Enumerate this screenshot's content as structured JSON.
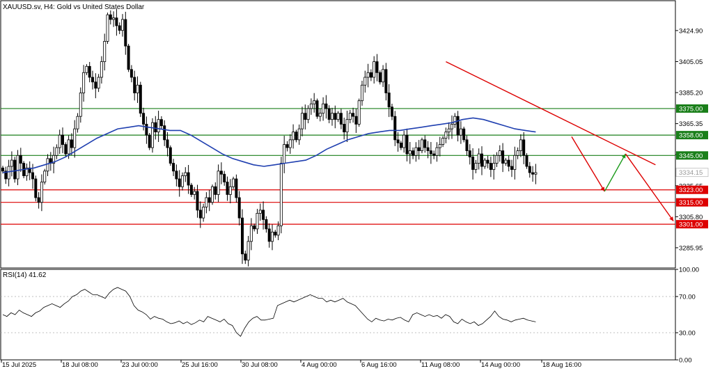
{
  "chart_data": {
    "type": "candlestick",
    "symbol_title": "XAUUSD.sv, H4:  Gold vs United States Dollar",
    "ylim": [
      3273,
      3444
    ],
    "y_ticks": [
      3424.9,
      3405.05,
      3385.2,
      3365.35,
      3345.5,
      3325.65,
      3305.8,
      3285.95
    ],
    "x_ticks": [
      "15 Jul 2025",
      "18 Jul 08:00",
      "23 Jul 00:00",
      "25 Jul 16:00",
      "30 Jul 08:00",
      "4 Aug 00:00",
      "6 Aug 16:00",
      "11 Aug 08:00",
      "14 Aug 00:00",
      "18 Aug 16:00"
    ],
    "current_price": "3334.15",
    "levels": [
      {
        "value": 3375.0,
        "label": "3375.00",
        "color": "#1a7f1a"
      },
      {
        "value": 3358.0,
        "label": "3358.00",
        "color": "#1a7f1a"
      },
      {
        "value": 3345.0,
        "label": "3345.00",
        "color": "#1a7f1a"
      },
      {
        "value": 3323.0,
        "label": "3323.00",
        "color": "#dd0000"
      },
      {
        "value": 3315.0,
        "label": "3315.00",
        "color": "#dd0000"
      },
      {
        "value": 3301.0,
        "label": "3301.00",
        "color": "#dd0000"
      }
    ],
    "closes": [
      3335,
      3330,
      3338,
      3342,
      3330,
      3345,
      3340,
      3332,
      3337,
      3334,
      3330,
      3318,
      3315,
      3328,
      3335,
      3343,
      3340,
      3345,
      3350,
      3358,
      3352,
      3346,
      3355,
      3350,
      3362,
      3370,
      3385,
      3398,
      3402,
      3395,
      3392,
      3388,
      3395,
      3405,
      3418,
      3435,
      3432,
      3433,
      3428,
      3425,
      3432,
      3415,
      3400,
      3395,
      3385,
      3390,
      3372,
      3365,
      3358,
      3350,
      3366,
      3360,
      3368,
      3364,
      3355,
      3350,
      3340,
      3335,
      3330,
      3325,
      3332,
      3334,
      3326,
      3320,
      3322,
      3310,
      3305,
      3312,
      3318,
      3315,
      3325,
      3320,
      3335,
      3333,
      3328,
      3320,
      3325,
      3330,
      3318,
      3305,
      3282,
      3278,
      3290,
      3300,
      3298,
      3308,
      3310,
      3304,
      3298,
      3290,
      3296,
      3294,
      3300,
      3340,
      3352,
      3350,
      3355,
      3360,
      3355,
      3362,
      3372,
      3368,
      3375,
      3378,
      3380,
      3370,
      3372,
      3378,
      3375,
      3368,
      3372,
      3368,
      3372,
      3365,
      3360,
      3368,
      3372,
      3370,
      3365,
      3380,
      3390,
      3395,
      3398,
      3395,
      3405,
      3398,
      3392,
      3400,
      3385,
      3376,
      3370,
      3355,
      3353,
      3350,
      3358,
      3346,
      3348,
      3345,
      3350,
      3348,
      3355,
      3350,
      3348,
      3346,
      3345,
      3350,
      3352,
      3356,
      3360,
      3362,
      3365,
      3370,
      3358,
      3362,
      3355,
      3348,
      3344,
      3336,
      3340,
      3346,
      3338,
      3342,
      3340,
      3336,
      3340,
      3345,
      3348,
      3340,
      3342,
      3338,
      3336,
      3345,
      3348,
      3355,
      3345,
      3338,
      3334,
      3333,
      3334
    ],
    "ma_values": [
      3334,
      3335,
      3336,
      3337,
      3339,
      3341,
      3344,
      3348,
      3352,
      3356,
      3359,
      3362,
      3363,
      3364,
      3363,
      3362,
      3361,
      3361,
      3358,
      3354,
      3350,
      3346,
      3343,
      3341,
      3339,
      3338,
      3339,
      3340,
      3341,
      3342,
      3345,
      3349,
      3352,
      3355,
      3357,
      3359,
      3360,
      3361,
      3361,
      3362,
      3363,
      3364,
      3365,
      3366,
      3368,
      3369,
      3368,
      3366,
      3364,
      3362,
      3361,
      3360
    ],
    "rsi": {
      "label": "RSI(14) 41.62",
      "ylim": [
        0,
        100
      ],
      "y_ticks": [
        "100.00",
        "70.00",
        "30.00",
        "0.00"
      ],
      "values": [
        50,
        48,
        52,
        50,
        55,
        52,
        50,
        48,
        52,
        54,
        58,
        60,
        62,
        60,
        58,
        62,
        65,
        70,
        72,
        76,
        78,
        75,
        72,
        72,
        70,
        68,
        74,
        78,
        80,
        78,
        76,
        70,
        60,
        55,
        53,
        50,
        45,
        48,
        46,
        45,
        42,
        40,
        41,
        43,
        40,
        42,
        39,
        41,
        44,
        42,
        48,
        46,
        44,
        42,
        45,
        40,
        38,
        30,
        26,
        35,
        42,
        46,
        48,
        44,
        44,
        45,
        46,
        60,
        62,
        64,
        66,
        64,
        66,
        68,
        70,
        72,
        70,
        68,
        68,
        64,
        66,
        64,
        66,
        68,
        64,
        62,
        60,
        55,
        50,
        45,
        42,
        46,
        44,
        43,
        45,
        44,
        46,
        47,
        44,
        42,
        50,
        52,
        50,
        48,
        50,
        48,
        49,
        46,
        50,
        48,
        42,
        40,
        45,
        42,
        40,
        42,
        38,
        40,
        44,
        48,
        54,
        48,
        45,
        44,
        42,
        44,
        45,
        46,
        44,
        43,
        42
      ]
    },
    "annotations": [
      {
        "type": "trendline",
        "color": "#dd0000",
        "from": {
          "i": 148,
          "v": 3405
        },
        "to": {
          "i": 218,
          "v": 3339
        }
      },
      {
        "type": "arrow",
        "color": "#dd0000",
        "from": {
          "i": 190,
          "v": 3357
        },
        "to": {
          "i": 201,
          "v": 3322
        }
      },
      {
        "type": "arrow",
        "color": "#1a9a1a",
        "from": {
          "i": 201,
          "v": 3322
        },
        "to": {
          "i": 208,
          "v": 3346
        }
      },
      {
        "type": "arrow",
        "color": "#dd0000",
        "from": {
          "i": 208,
          "v": 3346
        },
        "to": {
          "i": 224,
          "v": 3303
        }
      }
    ]
  }
}
